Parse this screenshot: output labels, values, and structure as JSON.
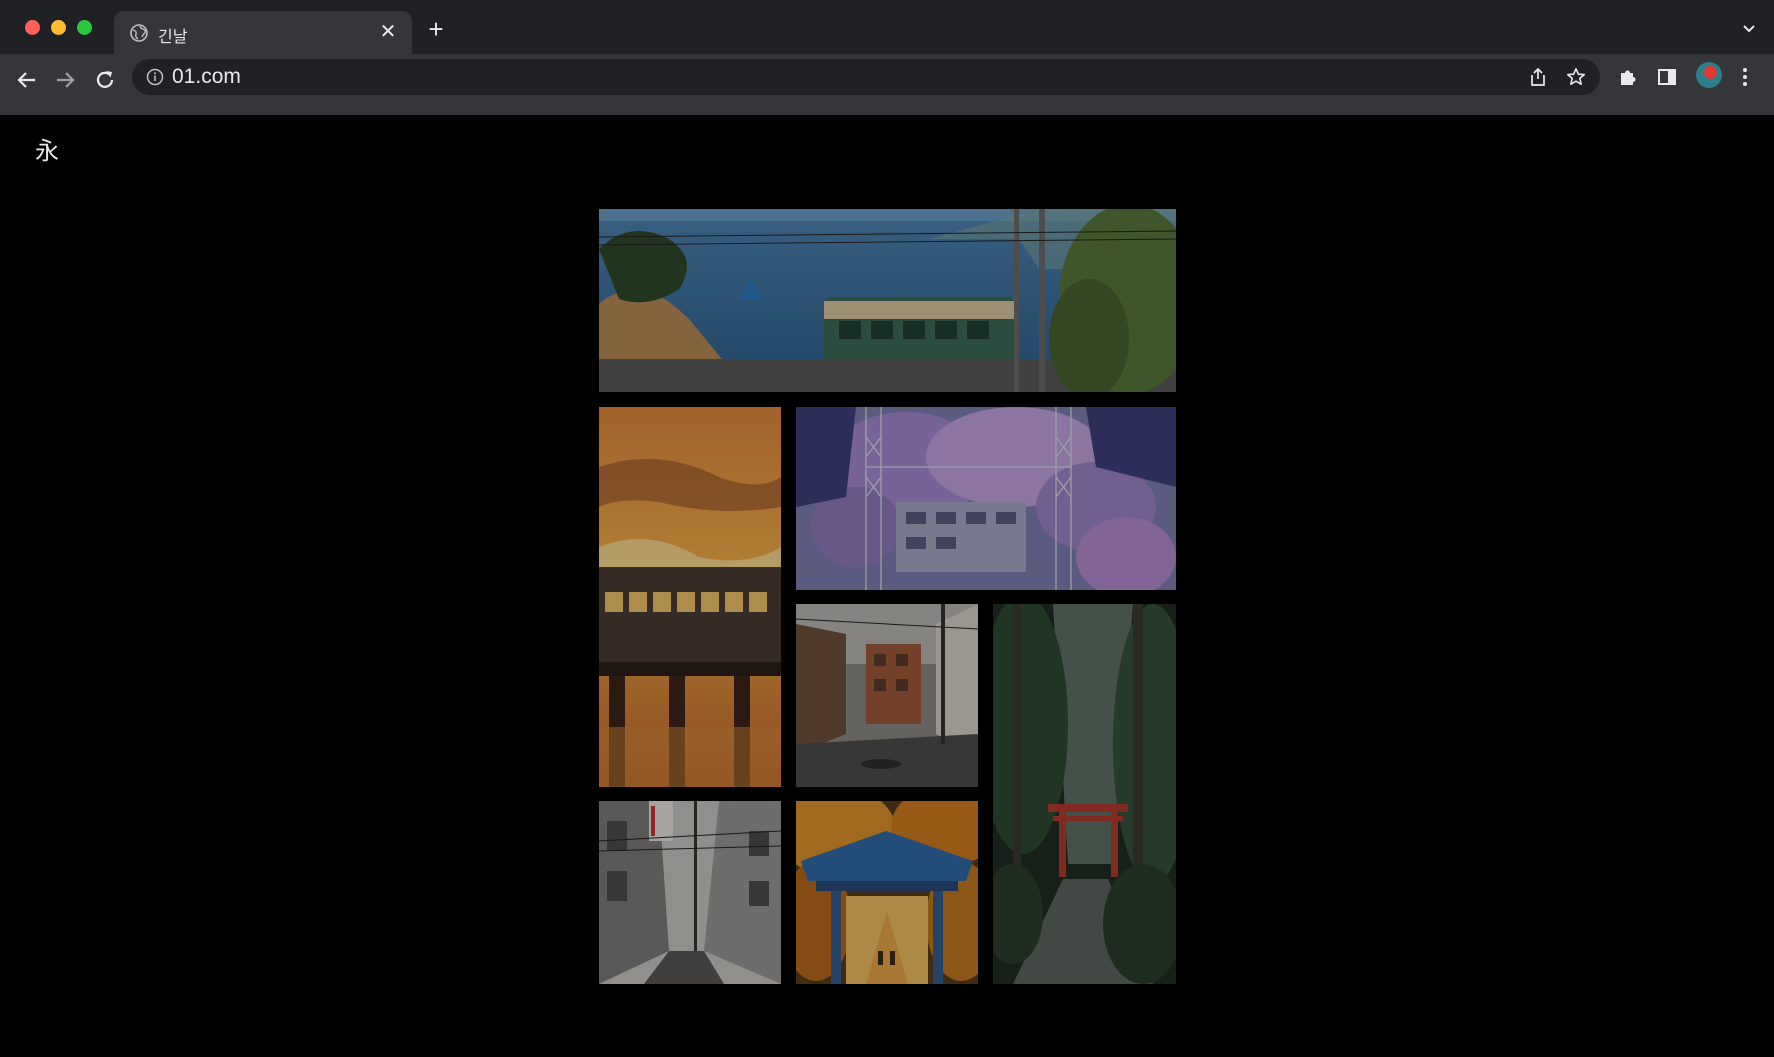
{
  "browser": {
    "tab": {
      "title": "긴날",
      "favicon": "globe-icon",
      "close_icon": "close-icon"
    },
    "new_tab_icon": "plus-icon",
    "tab_menu_icon": "chevron-down-icon",
    "nav": {
      "back_icon": "back-arrow-icon",
      "forward_icon": "forward-arrow-icon",
      "reload_icon": "reload-icon"
    },
    "address_bar": {
      "url": "01.com",
      "site_info_icon": "info-icon",
      "share_icon": "share-icon",
      "bookmark_icon": "star-icon"
    },
    "toolbar_icons": [
      "puzzle-icon",
      "side-panel-icon",
      "avatar",
      "kebab-menu-icon"
    ]
  },
  "page": {
    "logo": "永",
    "gallery": [
      {
        "name": "photo-coastal-tram",
        "subject": "coastal-tram"
      },
      {
        "name": "photo-sunset-bus-bridge",
        "subject": "sunset-bus-bridge"
      },
      {
        "name": "photo-wisteria-station",
        "subject": "wisteria-station"
      },
      {
        "name": "photo-street-corner",
        "subject": "street-corner"
      },
      {
        "name": "photo-forest-torii",
        "subject": "forest-torii"
      },
      {
        "name": "photo-narrow-alley",
        "subject": "narrow-alley"
      },
      {
        "name": "photo-temple-gate-autumn",
        "subject": "temple-gate-autumn"
      }
    ]
  },
  "colors": {
    "chrome_dark": "#202124",
    "chrome_toolbar": "#35363a",
    "page_background": "#000000",
    "text_light": "#e8eaed"
  }
}
